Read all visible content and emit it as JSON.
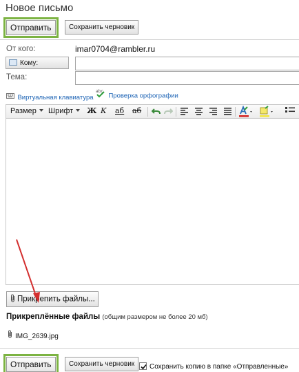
{
  "page": {
    "title": "Новое письмо"
  },
  "actions": {
    "send_label": "Отправить",
    "draft_label": "Сохранить черновик"
  },
  "form": {
    "from_label": "От кого:",
    "from_value": "imar0704@rambler.ru",
    "to_button_label": "Кому:",
    "to_value": "",
    "subject_label": "Тема:",
    "subject_value": ""
  },
  "tools": {
    "keyboard_link": "Виртуальная клавиатура",
    "spellcheck_link": "Проверка орфографии"
  },
  "toolbar": {
    "size_label": "Размер",
    "font_label": "Шрифт",
    "bold": "Ж",
    "italic": "К",
    "underline": "аб",
    "strike": "аб"
  },
  "attachments": {
    "attach_button_label": "Прикрепить файлы...",
    "title": "Прикреплённые файлы",
    "note": "(общим размером не более 20 мб)",
    "files": [
      {
        "name": "IMG_2639.jpg"
      }
    ]
  },
  "footer": {
    "send_label": "Отправить",
    "draft_label": "Сохранить черновик",
    "save_copy_label": "Сохранить копию в папке «Отправленные»",
    "save_copy_checked": true
  },
  "colors": {
    "send_highlight": "#7cb342",
    "link": "#1b62b4",
    "arrow": "#d32f2f"
  }
}
